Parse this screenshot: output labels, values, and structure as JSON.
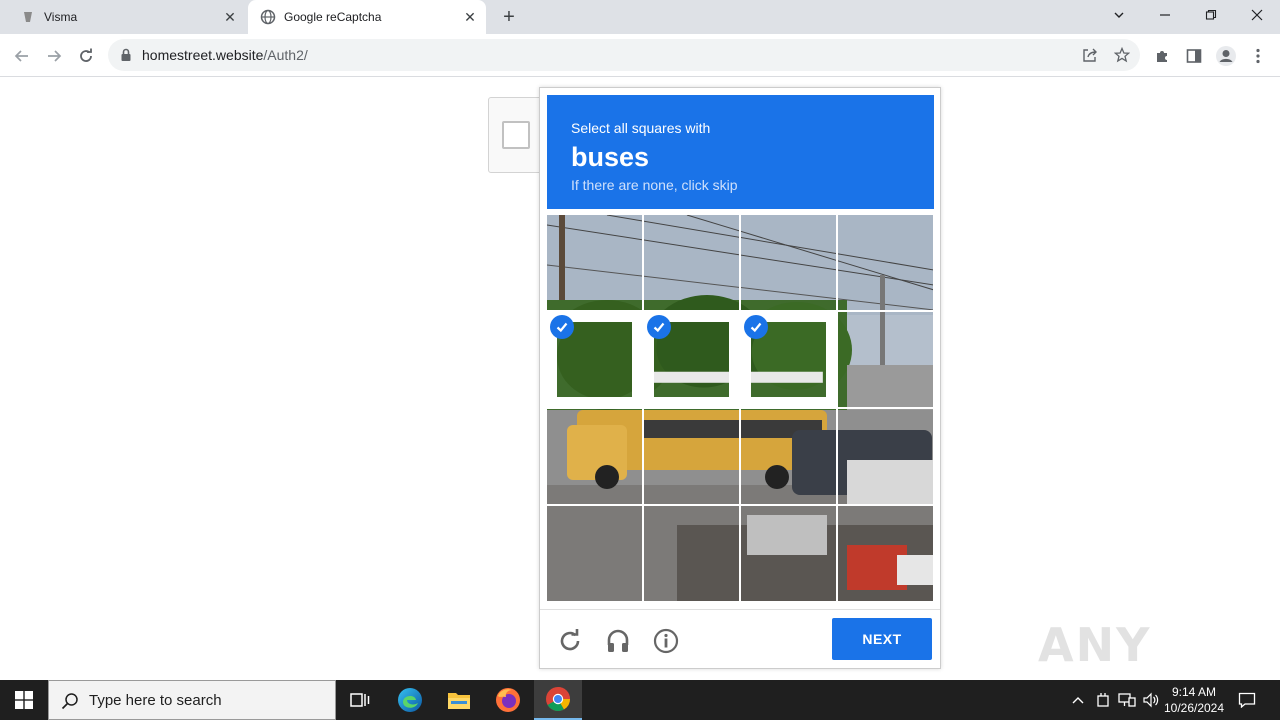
{
  "browser": {
    "tabs": [
      {
        "title": "Visma",
        "active": false
      },
      {
        "title": "Google reCaptcha",
        "active": true
      }
    ],
    "url": {
      "host": "homestreet.website",
      "path": "/Auth2/"
    }
  },
  "captcha": {
    "instruction_line1": "Select all squares with",
    "object": "buses",
    "instruction_line3": "If there are none, click skip",
    "grid": {
      "rows": 4,
      "cols": 4,
      "selected": [
        [
          false,
          false,
          false,
          false
        ],
        [
          true,
          true,
          true,
          false
        ],
        [
          false,
          false,
          false,
          false
        ],
        [
          false,
          false,
          false,
          false
        ]
      ]
    },
    "next_label": "NEXT",
    "accent_color": "#1a73e8"
  },
  "watermark": "ANY RUN",
  "taskbar": {
    "search_placeholder": "Type here to search",
    "time": "9:14 AM",
    "date": "10/26/2024"
  }
}
